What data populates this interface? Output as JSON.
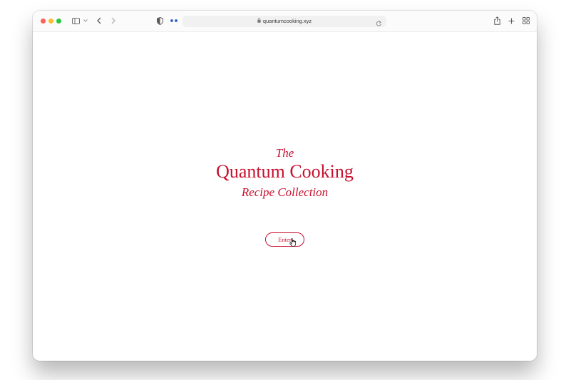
{
  "browser": {
    "url": "quantumcooking.xyz"
  },
  "page": {
    "title_the": "The",
    "title_main": "Quantum Cooking",
    "title_sub": "Recipe Collection",
    "enter_label": "Enter"
  },
  "colors": {
    "accent": "#c8102e",
    "close": "#ff5f57",
    "minimize": "#febc2e",
    "maximize": "#28c840"
  },
  "icons": [
    "sidebar-icon",
    "chevron-down-icon",
    "back-icon",
    "forward-icon",
    "shield-icon",
    "extension-icon",
    "lock-icon",
    "reload-icon",
    "share-icon",
    "new-tab-icon",
    "tab-overview-icon",
    "pointer-cursor-icon"
  ]
}
